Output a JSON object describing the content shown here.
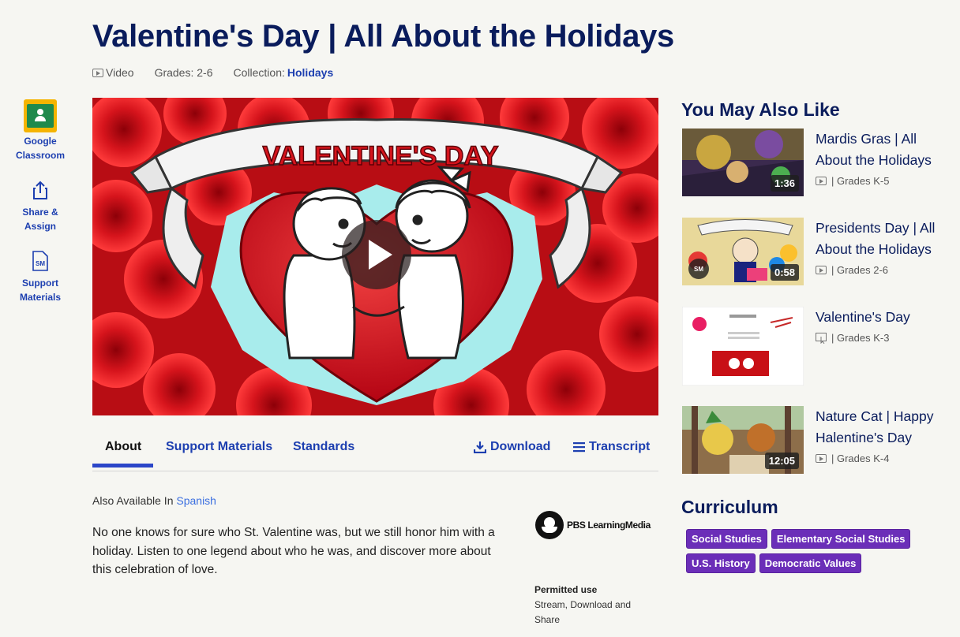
{
  "page": {
    "title": "Valentine's Day | All About the Holidays",
    "meta": {
      "type": "Video",
      "grades": "Grades: 2-6",
      "collection_label": "Collection:",
      "collection_link": "Holidays"
    }
  },
  "rail": {
    "google": "Google Classroom",
    "share": "Share & Assign",
    "support": "Support Materials",
    "sm_badge": "SM"
  },
  "player": {
    "banner_text": "VALENTINE'S DAY",
    "play_icon": "play-icon"
  },
  "tabs": {
    "about": "About",
    "support": "Support Materials",
    "standards": "Standards",
    "download": "Download",
    "transcript": "Transcript"
  },
  "about": {
    "also_label": "Also Available In",
    "also_link": "Spanish",
    "description": "No one knows for sure who St. Valentine was, but we still honor him with a holiday. Listen to one legend about who he was, and discover more about this celebration of love."
  },
  "brand": {
    "logo_text": "PBS LearningMedia",
    "permitted_head": "Permitted use",
    "permitted_body": "Stream, Download and Share"
  },
  "recommendations": {
    "heading": "You May Also Like",
    "items": [
      {
        "title": "Mardis Gras | All About the Holidays",
        "grades": "| Grades K-5",
        "duration": "1:36",
        "kind": "video"
      },
      {
        "title": "Presidents Day | All About the Holidays",
        "grades": "| Grades 2-6",
        "duration": "0:58",
        "kind": "video",
        "badge": "SM"
      },
      {
        "title": "Valentine's Day",
        "grades": "| Grades K-3",
        "duration": "",
        "kind": "interactive"
      },
      {
        "title": "Nature Cat | Happy Halentine's Day",
        "grades": "| Grades K-4",
        "duration": "12:05",
        "kind": "video"
      }
    ]
  },
  "curriculum": {
    "heading": "Curriculum",
    "tags": [
      "Social Studies",
      "Elementary Social Studies",
      "U.S. History",
      "Democratic Values"
    ]
  },
  "colors": {
    "heading": "#0a1c5c",
    "link": "#1d3fb0",
    "tag": "#6b2eb8",
    "tab_underline": "#2b46c8"
  }
}
